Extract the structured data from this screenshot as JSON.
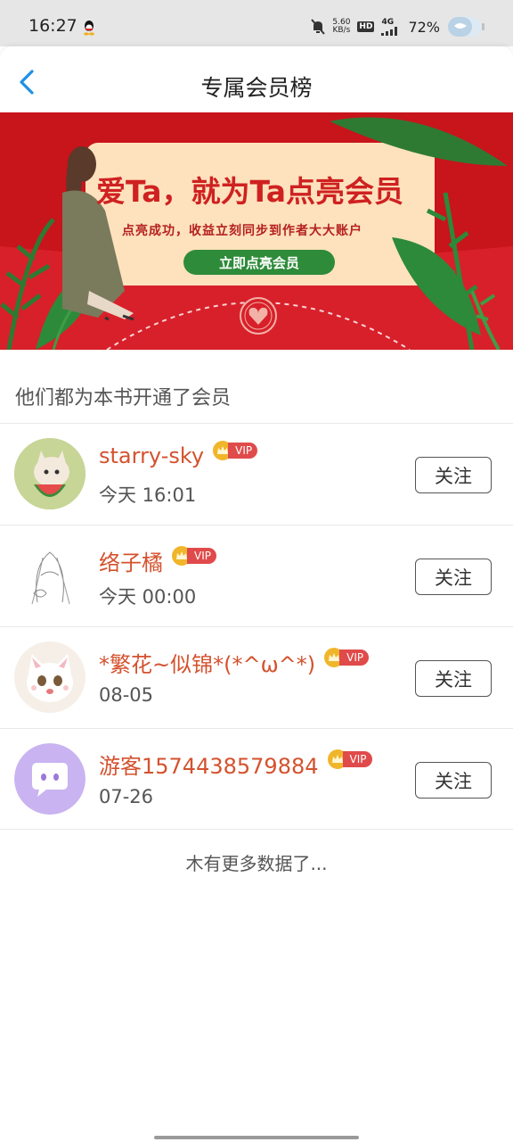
{
  "status_bar": {
    "time": "16:27",
    "net_speed_value": "5.60",
    "net_speed_unit": "KB/s",
    "hd": "HD",
    "network": "4G",
    "battery": "72%"
  },
  "header": {
    "title": "专属会员榜"
  },
  "banner": {
    "headline": "爱Ta，就为Ta点亮会员",
    "subline": "点亮成功，收益立刻同步到作者大大账户",
    "cta_label": "立即点亮会员"
  },
  "section_title": "他们都为本书开通了会员",
  "vip_label": "VIP",
  "follow_label": "关注",
  "members": [
    {
      "name": "starry-sky",
      "time": "今天 16:01"
    },
    {
      "name": "络子橘",
      "time": "今天 00:00"
    },
    {
      "name": "*繁花~似锦*(*^ω^*)",
      "time": "08-05"
    },
    {
      "name": "游客1574438579884",
      "time": "07-26"
    }
  ],
  "footer_text": "木有更多数据了...",
  "colors": {
    "accent": "#d4522e",
    "banner_red": "#c8141b",
    "back_arrow": "#1e90e6",
    "vip_tag": "#e04a4a",
    "vip_crown": "#f0b62b"
  }
}
